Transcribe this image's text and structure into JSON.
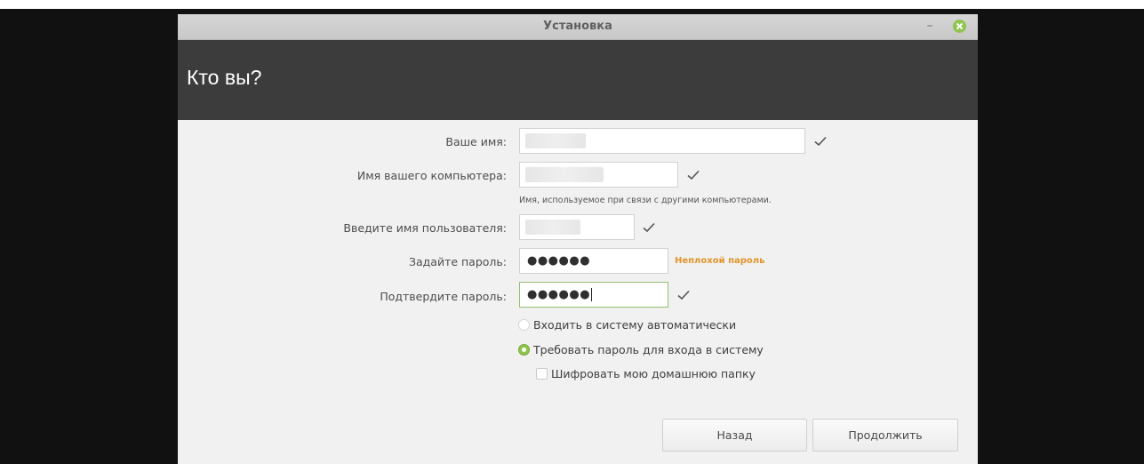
{
  "window": {
    "title": "Установка",
    "minimize_glyph": "–",
    "close_icon": "close-icon"
  },
  "page": {
    "heading": "Кто вы?"
  },
  "form": {
    "name_label": "Ваше имя:",
    "computer_label": "Имя вашего компьютера:",
    "computer_hint": "Имя, используемое при связи с другими компьютерами.",
    "username_label": "Введите имя пользователя:",
    "password_label": "Задайте пароль:",
    "password_value": "●●●●●●",
    "password_strength": "Неплохой пароль",
    "confirm_label": "Подтвердите пароль:",
    "confirm_value": "●●●●●●"
  },
  "options": {
    "autologin_label": "Входить в систему автоматически",
    "autologin_selected": false,
    "require_password_label": "Требовать пароль для входа в систему",
    "require_password_selected": true,
    "encrypt_home_label": "Шифровать мою домашнюю папку",
    "encrypt_home_checked": false
  },
  "buttons": {
    "back_label": "Назад",
    "continue_label": "Продолжить"
  },
  "colors": {
    "accent_green": "#8fc54d",
    "strength_orange": "#e0942a",
    "header_dark": "#3c3c3c"
  }
}
